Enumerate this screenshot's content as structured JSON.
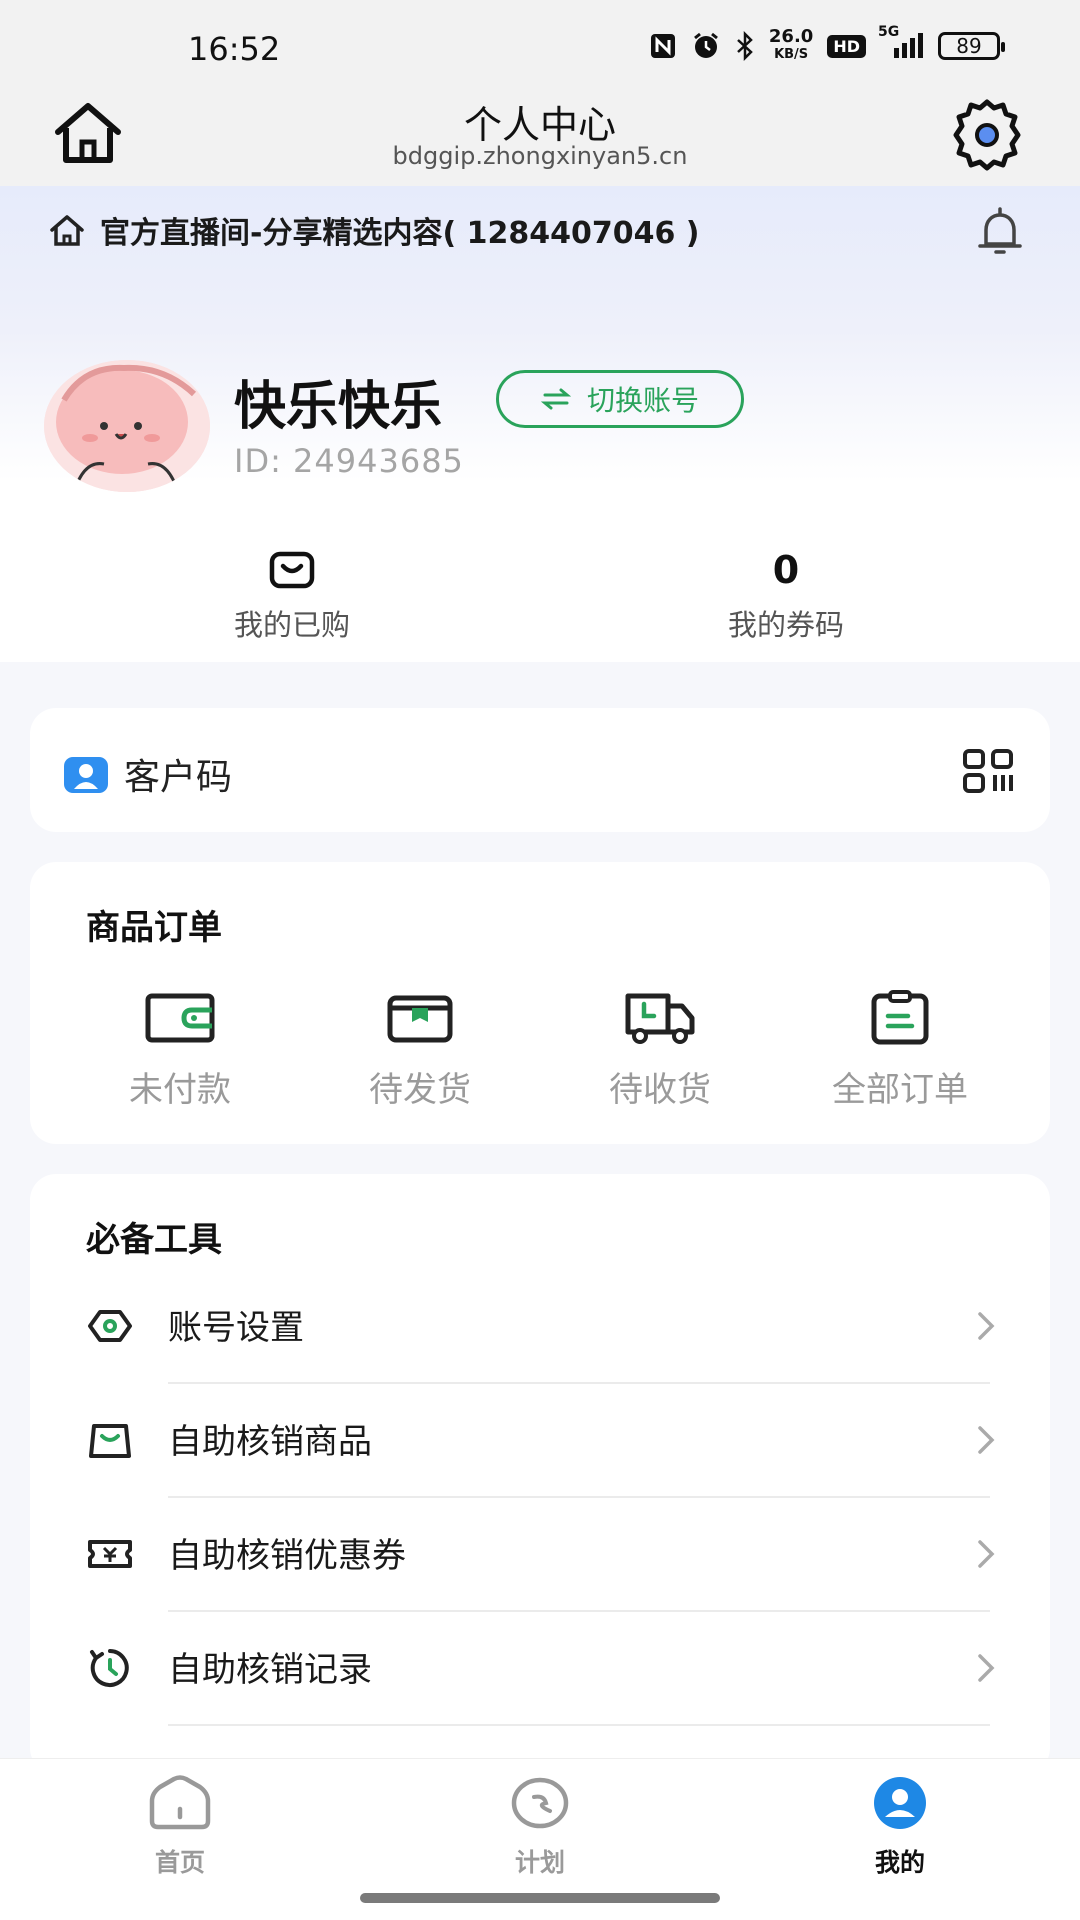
{
  "status_bar": {
    "time": "16:52",
    "net_speed_value": "26.0",
    "net_speed_unit": "KB/S",
    "hd": "HD",
    "network": "5G",
    "battery": "89"
  },
  "header": {
    "title": "个人中心",
    "subtitle": "bdggip.zhongxinyan5.cn"
  },
  "notice": {
    "text": "官方直播间-分享精选内容( 1284407046 )"
  },
  "profile": {
    "name": "快乐快乐",
    "switch_label": "切换账号",
    "id_text": "ID: 24943685"
  },
  "stats": [
    {
      "value": "",
      "label": "我的已购"
    },
    {
      "value": "0",
      "label": "我的券码"
    }
  ],
  "customer_code": {
    "label": "客户码"
  },
  "orders": {
    "title": "商品订单",
    "items": [
      {
        "label": "未付款",
        "icon": "wallet-icon"
      },
      {
        "label": "待发货",
        "icon": "box-icon"
      },
      {
        "label": "待收货",
        "icon": "truck-icon"
      },
      {
        "label": "全部订单",
        "icon": "clipboard-icon"
      }
    ]
  },
  "tools": {
    "title": "必备工具",
    "items": [
      {
        "label": "账号设置",
        "icon": "account-settings-icon"
      },
      {
        "label": "自助核销商品",
        "icon": "product-verify-icon"
      },
      {
        "label": "自助核销优惠券",
        "icon": "coupon-verify-icon"
      },
      {
        "label": "自助核销记录",
        "icon": "history-icon"
      }
    ]
  },
  "bottom_nav": [
    {
      "label": "首页",
      "icon": "home-icon",
      "active": false
    },
    {
      "label": "计划",
      "icon": "plan-icon",
      "active": false
    },
    {
      "label": "我的",
      "icon": "profile-icon",
      "active": true
    }
  ],
  "colors": {
    "accent_green": "#2aa35b",
    "nav_active_blue": "#1e88e5",
    "label_gray": "#9a9a9a"
  }
}
